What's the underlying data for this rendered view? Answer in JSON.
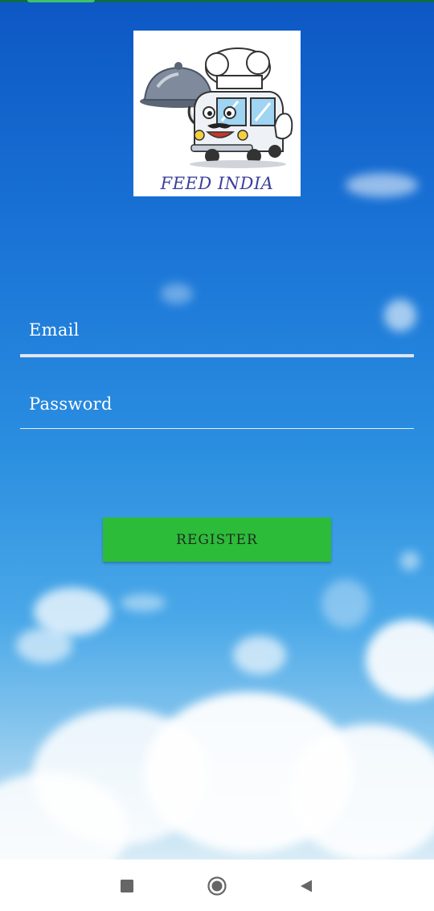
{
  "logo": {
    "text": "FEED INDIA",
    "icon": "food-truck-chef-logo"
  },
  "form": {
    "email_placeholder": "Email",
    "password_placeholder": "Password",
    "register_label": "REGISTER"
  },
  "nav": {
    "recents_icon": "square-icon",
    "home_icon": "circle-icon",
    "back_icon": "triangle-back-icon"
  },
  "colors": {
    "register_button": "#2dbb3a",
    "logo_text": "#3a3f9e",
    "sky_top": "#0d57c4"
  }
}
